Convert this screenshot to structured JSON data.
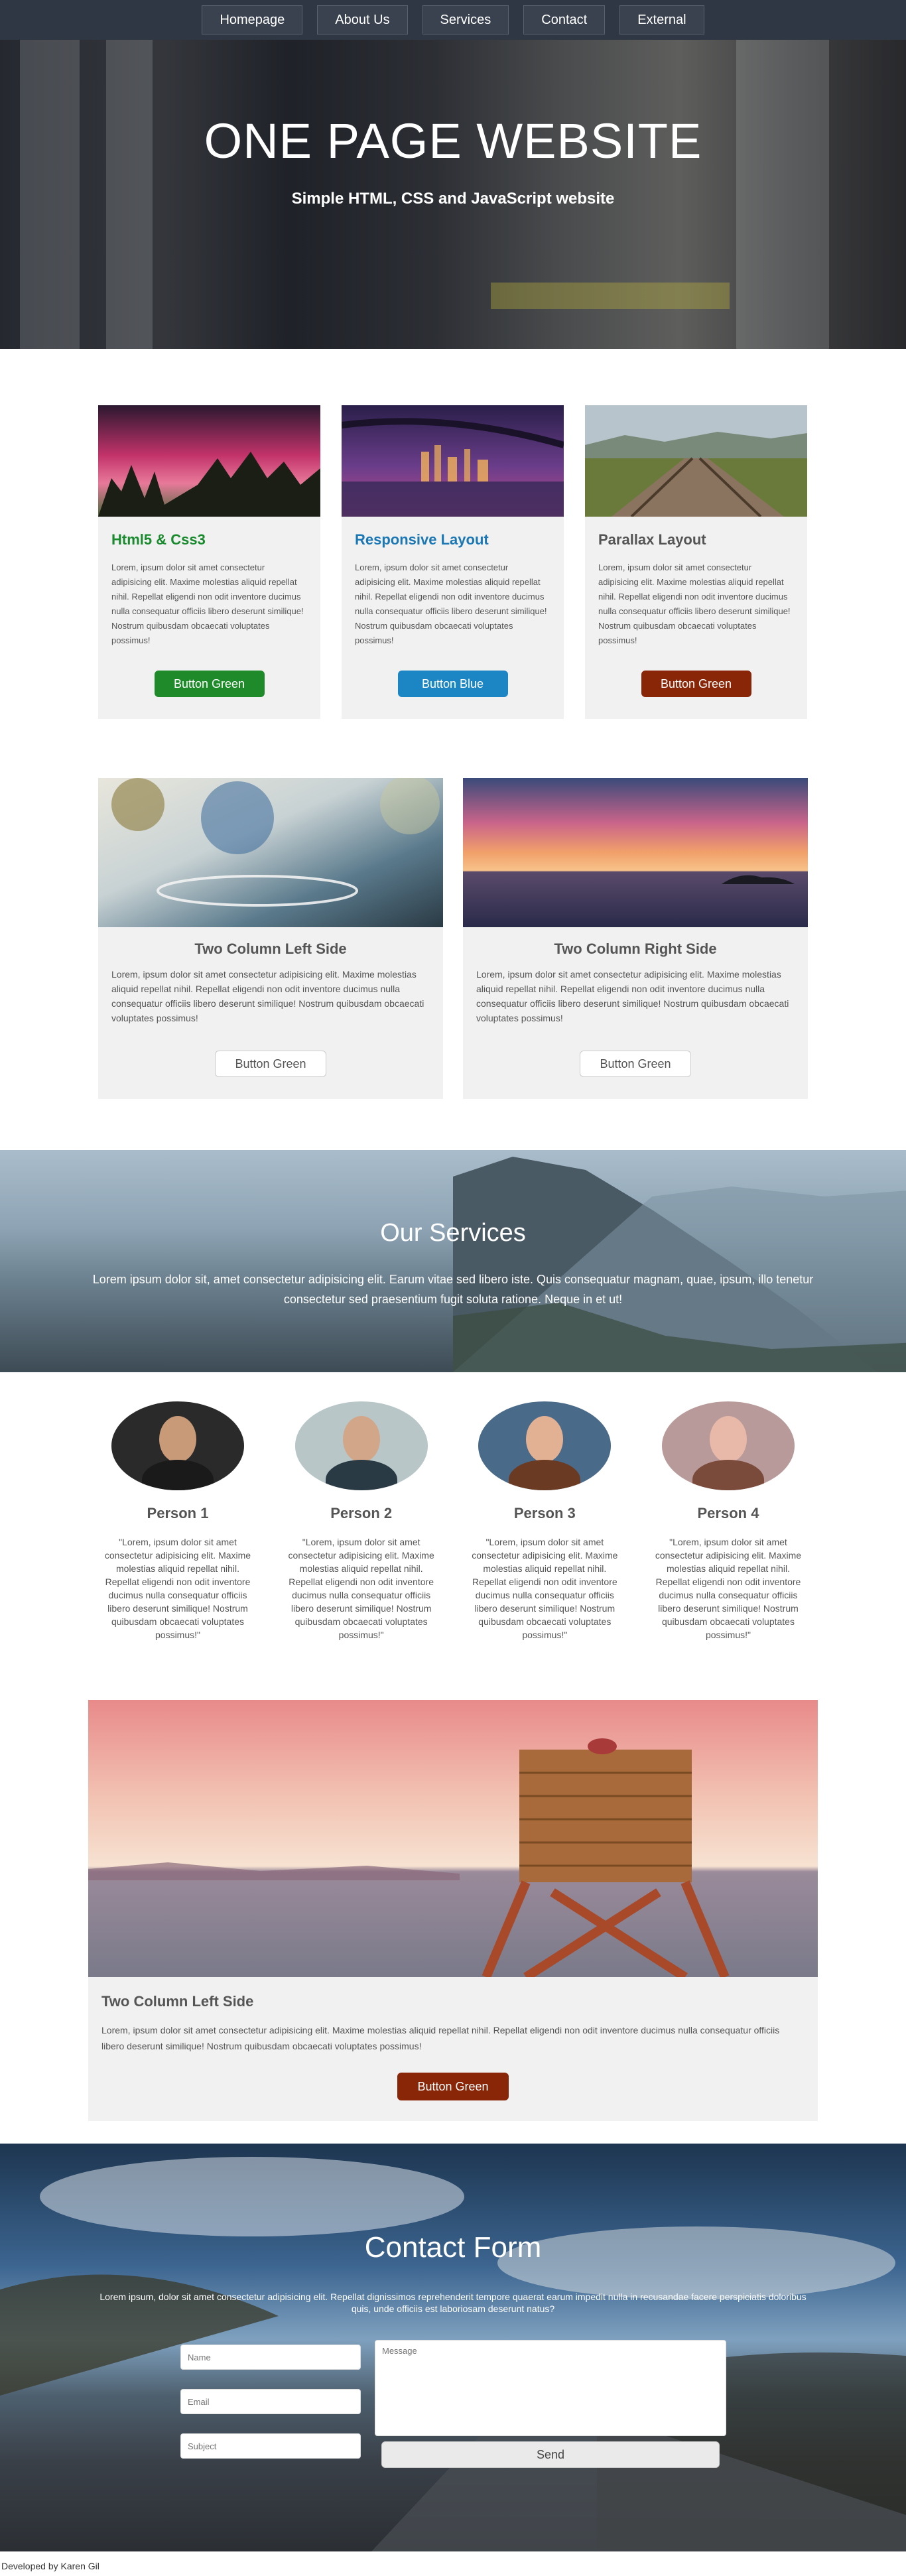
{
  "nav": {
    "items": [
      {
        "label": "Homepage"
      },
      {
        "label": "About Us"
      },
      {
        "label": "Services"
      },
      {
        "label": "Contact"
      },
      {
        "label": "External"
      }
    ]
  },
  "hero": {
    "title": "ONE PAGE WEBSITE",
    "subtitle": "Simple HTML, CSS and JavaScript website"
  },
  "features": [
    {
      "title": "Html5 & Css3",
      "title_color": "#1a8a2f",
      "text": "Lorem, ipsum dolor sit amet consectetur adipisicing elit. Maxime molestias aliquid repellat nihil. Repellat eligendi non odit inventore ducimus nulla consequatur officiis libero deserunt similique! Nostrum quibusdam obcaecati voluptates possimus!",
      "button": "Button Green",
      "button_color": "#1f8a2a"
    },
    {
      "title": "Responsive Layout",
      "title_color": "#1b78b4",
      "text": "Lorem, ipsum dolor sit amet consectetur adipisicing elit. Maxime molestias aliquid repellat nihil. Repellat eligendi non odit inventore ducimus nulla consequatur officiis libero deserunt similique! Nostrum quibusdam obcaecati voluptates possimus!",
      "button": "Button Blue",
      "button_color": "#1c85c4"
    },
    {
      "title": "Parallax Layout",
      "title_color": "#555555",
      "text": "Lorem, ipsum dolor sit amet consectetur adipisicing elit. Maxime molestias aliquid repellat nihil. Repellat eligendi non odit inventore ducimus nulla consequatur officiis libero deserunt similique! Nostrum quibusdam obcaecati voluptates possimus!",
      "button": "Button Green",
      "button_color": "#8a2608"
    }
  ],
  "columns": [
    {
      "title": "Two Column Left Side",
      "text": "Lorem, ipsum dolor sit amet consectetur adipisicing elit. Maxime molestias aliquid repellat nihil. Repellat eligendi non odit inventore ducimus nulla consequatur officiis libero deserunt similique! Nostrum quibusdam obcaecati voluptates possimus!",
      "button": "Button Green"
    },
    {
      "title": "Two Column Right Side",
      "text": "Lorem, ipsum dolor sit amet consectetur adipisicing elit. Maxime molestias aliquid repellat nihil. Repellat eligendi non odit inventore ducimus nulla consequatur officiis libero deserunt similique! Nostrum quibusdam obcaecati voluptates possimus!",
      "button": "Button Green"
    }
  ],
  "services": {
    "title": "Our Services",
    "text": "Lorem ipsum dolor sit, amet consectetur adipisicing elit. Earum vitae sed libero iste. Quis consequatur magnam, quae, ipsum, illo tenetur consectetur sed praesentium fugit soluta ratione. Neque in et ut!"
  },
  "people": [
    {
      "name": "Person 1",
      "quote": "\"Lorem, ipsum dolor sit amet consectetur adipisicing elit. Maxime molestias aliquid repellat nihil. Repellat eligendi non odit inventore ducimus nulla consequatur officiis libero deserunt similique! Nostrum quibusdam obcaecati voluptates possimus!\""
    },
    {
      "name": "Person 2",
      "quote": "\"Lorem, ipsum dolor sit amet consectetur adipisicing elit. Maxime molestias aliquid repellat nihil. Repellat eligendi non odit inventore ducimus nulla consequatur officiis libero deserunt similique! Nostrum quibusdam obcaecati voluptates possimus!\""
    },
    {
      "name": "Person 3",
      "quote": "\"Lorem, ipsum dolor sit amet consectetur adipisicing elit. Maxime molestias aliquid repellat nihil. Repellat eligendi non odit inventore ducimus nulla consequatur officiis libero deserunt similique! Nostrum quibusdam obcaecati voluptates possimus!\""
    },
    {
      "name": "Person 4",
      "quote": "\"Lorem, ipsum dolor sit amet consectetur adipisicing elit. Maxime molestias aliquid repellat nihil. Repellat eligendi non odit inventore ducimus nulla consequatur officiis libero deserunt similique! Nostrum quibusdam obcaecati voluptates possimus!\""
    }
  ],
  "wide": {
    "title": "Two Column Left Side",
    "text": "Lorem, ipsum dolor sit amet consectetur adipisicing elit. Maxime molestias aliquid repellat nihil. Repellat eligendi non odit inventore ducimus nulla consequatur officiis libero deserunt similique! Nostrum quibusdam obcaecati voluptates possimus!",
    "button": "Button Green",
    "button_color": "#8a2608"
  },
  "contact": {
    "title": "Contact Form",
    "text": "Lorem ipsum, dolor sit amet consectetur adipisicing elit. Repellat dignissimos reprehenderit tempore quaerat earum impedit nulla in recusandae facere perspiciatis doloribus quis, unde officiis est laboriosam deserunt natus?",
    "name_placeholder": "Name",
    "email_placeholder": "Email",
    "subject_placeholder": "Subject",
    "message_placeholder": "Message",
    "send": "Send"
  },
  "footer": {
    "text": "Developed by Karen Gil"
  }
}
